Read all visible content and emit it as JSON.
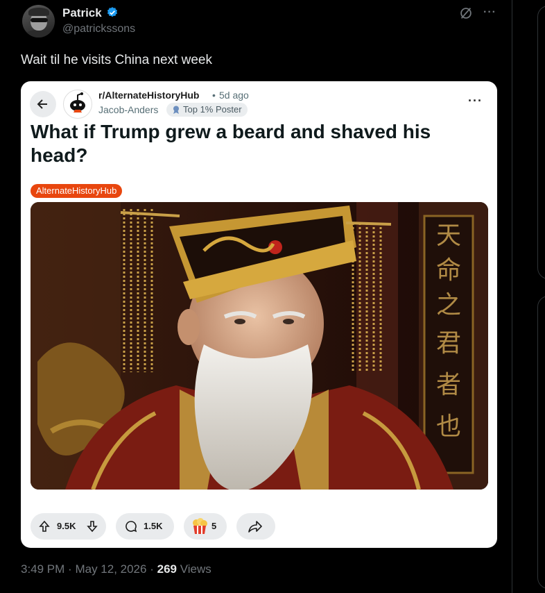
{
  "tweet": {
    "author_name": "Patrick",
    "author_handle": "@patrickssons",
    "text": "Wait til he visits China next week",
    "more_icon": "ellipsis-icon",
    "grok_icon": "grok-icon",
    "verified_color": "#1d9bf0"
  },
  "embed": {
    "subreddit": "r/AlternateHistoryHub",
    "separator": "•",
    "time_ago": "5d ago",
    "author": "Jacob-Anders",
    "badge": "Top 1% Poster",
    "title": "What if Trump grew a beard and shaved his head?",
    "flair": "AlternateHistoryHub",
    "flair_color": "#e8460e",
    "image_text": [
      "天",
      "命",
      "之",
      "君",
      "者",
      "也"
    ],
    "upvotes": "9.5K",
    "comments": "1.5K",
    "awards": "5"
  },
  "meta": {
    "time": "3:49 PM",
    "dot1": "·",
    "date": "May 12, 2026",
    "dot2": "·",
    "views_count": "269",
    "views_label": "Views"
  }
}
